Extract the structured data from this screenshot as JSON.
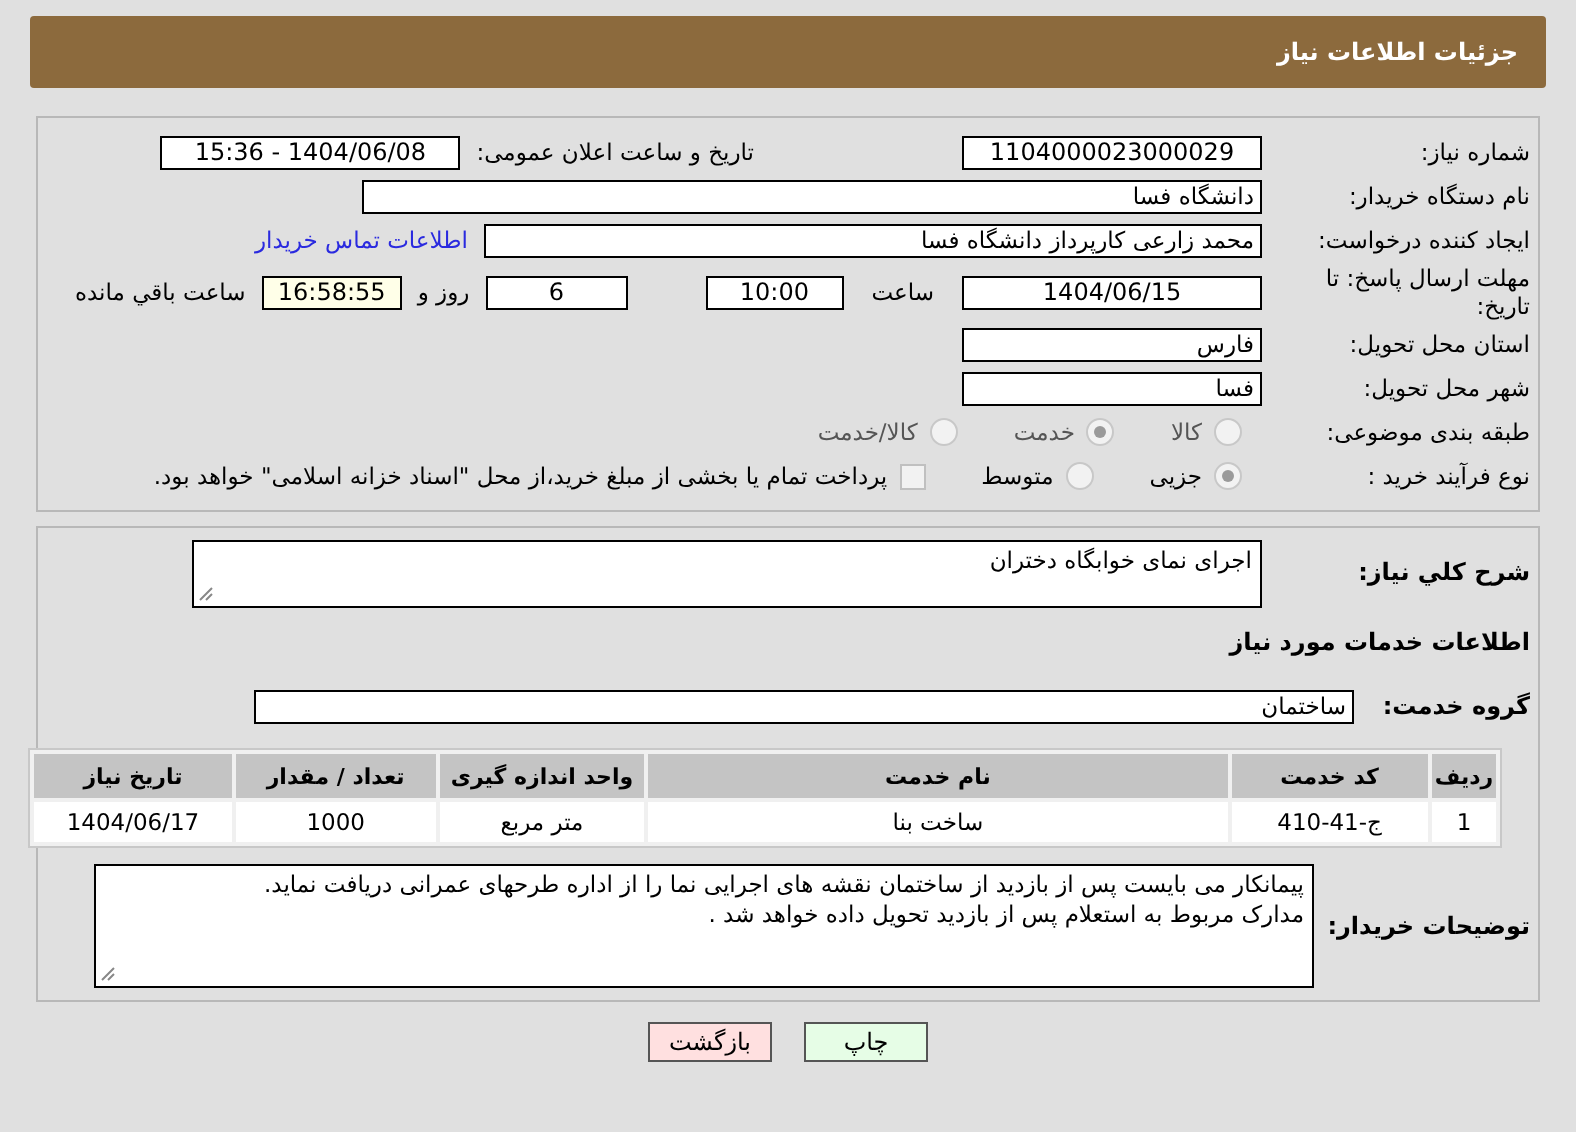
{
  "header": {
    "title": "جزئیات اطلاعات نیاز"
  },
  "details": {
    "need_number": {
      "label": "شماره نیاز:",
      "value": "1104000023000029"
    },
    "announce": {
      "label": "تاریخ و ساعت اعلان عمومی:",
      "value": "1404/06/08 - 15:36"
    },
    "buyer_org": {
      "label": "نام دستگاه خریدار:",
      "value": "دانشگاه فسا"
    },
    "creator": {
      "label": "ایجاد کننده درخواست:",
      "value": "محمد زارعی کارپرداز دانشگاه فسا"
    },
    "contact_link": "اطلاعات تماس خریدار",
    "deadline": {
      "label": "مهلت ارسال پاسخ: تا تاریخ:",
      "date": "1404/06/15",
      "time_label": "ساعت",
      "time": "10:00",
      "days": "6",
      "days_label": "روز و",
      "remaining": "16:58:55",
      "remaining_label": "ساعت باقي مانده"
    },
    "province": {
      "label": "استان محل تحویل:",
      "value": "فارس"
    },
    "city": {
      "label": "شهر محل تحویل:",
      "value": "فسا"
    },
    "category": {
      "label": "طبقه بندی موضوعی:",
      "options": [
        {
          "label": "کالا",
          "selected": false
        },
        {
          "label": "خدمت",
          "selected": true
        },
        {
          "label": "کالا/خدمت",
          "selected": false
        }
      ]
    },
    "process": {
      "label": "نوع فرآیند خرید :",
      "options": [
        {
          "label": "جزیی",
          "selected": true
        },
        {
          "label": "متوسط",
          "selected": false
        }
      ],
      "payment": {
        "label": "پرداخت تمام یا بخشی از مبلغ خرید،از محل \"اسناد خزانه اسلامی\" خواهد بود.",
        "checked": false
      }
    }
  },
  "summary": {
    "label": "شرح کلي نياز:",
    "value": "اجرای نمای خوابگاه دختران"
  },
  "services_title": "اطلاعات خدمات مورد نیاز",
  "service_group": {
    "label": "گروه خدمت:",
    "value": "ساختمان"
  },
  "table": {
    "columns": [
      "ردیف",
      "کد خدمت",
      "نام خدمت",
      "واحد اندازه گیری",
      "تعداد / مقدار",
      "تاریخ نیاز"
    ],
    "rows": [
      [
        "1",
        "ج-41-410",
        "ساخت بنا",
        "متر مربع",
        "1000",
        "1404/06/17"
      ]
    ]
  },
  "buyer_notes": {
    "label": "توضیحات خریدار:",
    "lines": [
      "پیمانکار می بایست پس از بازدید از ساختمان نقشه های اجرایی نما را از اداره طرحهای عمرانی دریافت نماید.",
      "مدارک مربوط به استعلام پس از بازدید تحویل داده خواهد شد ."
    ]
  },
  "buttons": [
    {
      "label": "چاپ",
      "kind": "print"
    },
    {
      "label": "بازگشت",
      "kind": "back"
    }
  ]
}
